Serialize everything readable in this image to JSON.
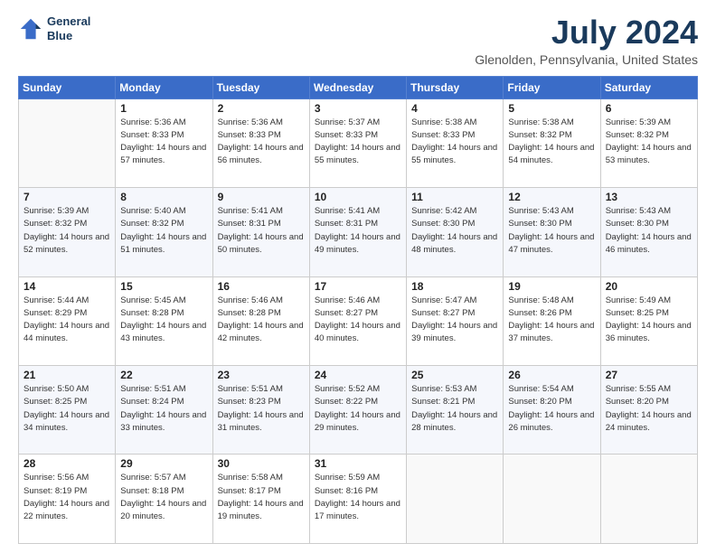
{
  "header": {
    "logo_line1": "General",
    "logo_line2": "Blue",
    "title": "July 2024",
    "subtitle": "Glenolden, Pennsylvania, United States"
  },
  "weekdays": [
    "Sunday",
    "Monday",
    "Tuesday",
    "Wednesday",
    "Thursday",
    "Friday",
    "Saturday"
  ],
  "weeks": [
    [
      {
        "day": "",
        "sunrise": "",
        "sunset": "",
        "daylight": ""
      },
      {
        "day": "1",
        "sunrise": "Sunrise: 5:36 AM",
        "sunset": "Sunset: 8:33 PM",
        "daylight": "Daylight: 14 hours and 57 minutes."
      },
      {
        "day": "2",
        "sunrise": "Sunrise: 5:36 AM",
        "sunset": "Sunset: 8:33 PM",
        "daylight": "Daylight: 14 hours and 56 minutes."
      },
      {
        "day": "3",
        "sunrise": "Sunrise: 5:37 AM",
        "sunset": "Sunset: 8:33 PM",
        "daylight": "Daylight: 14 hours and 55 minutes."
      },
      {
        "day": "4",
        "sunrise": "Sunrise: 5:38 AM",
        "sunset": "Sunset: 8:33 PM",
        "daylight": "Daylight: 14 hours and 55 minutes."
      },
      {
        "day": "5",
        "sunrise": "Sunrise: 5:38 AM",
        "sunset": "Sunset: 8:32 PM",
        "daylight": "Daylight: 14 hours and 54 minutes."
      },
      {
        "day": "6",
        "sunrise": "Sunrise: 5:39 AM",
        "sunset": "Sunset: 8:32 PM",
        "daylight": "Daylight: 14 hours and 53 minutes."
      }
    ],
    [
      {
        "day": "7",
        "sunrise": "Sunrise: 5:39 AM",
        "sunset": "Sunset: 8:32 PM",
        "daylight": "Daylight: 14 hours and 52 minutes."
      },
      {
        "day": "8",
        "sunrise": "Sunrise: 5:40 AM",
        "sunset": "Sunset: 8:32 PM",
        "daylight": "Daylight: 14 hours and 51 minutes."
      },
      {
        "day": "9",
        "sunrise": "Sunrise: 5:41 AM",
        "sunset": "Sunset: 8:31 PM",
        "daylight": "Daylight: 14 hours and 50 minutes."
      },
      {
        "day": "10",
        "sunrise": "Sunrise: 5:41 AM",
        "sunset": "Sunset: 8:31 PM",
        "daylight": "Daylight: 14 hours and 49 minutes."
      },
      {
        "day": "11",
        "sunrise": "Sunrise: 5:42 AM",
        "sunset": "Sunset: 8:30 PM",
        "daylight": "Daylight: 14 hours and 48 minutes."
      },
      {
        "day": "12",
        "sunrise": "Sunrise: 5:43 AM",
        "sunset": "Sunset: 8:30 PM",
        "daylight": "Daylight: 14 hours and 47 minutes."
      },
      {
        "day": "13",
        "sunrise": "Sunrise: 5:43 AM",
        "sunset": "Sunset: 8:30 PM",
        "daylight": "Daylight: 14 hours and 46 minutes."
      }
    ],
    [
      {
        "day": "14",
        "sunrise": "Sunrise: 5:44 AM",
        "sunset": "Sunset: 8:29 PM",
        "daylight": "Daylight: 14 hours and 44 minutes."
      },
      {
        "day": "15",
        "sunrise": "Sunrise: 5:45 AM",
        "sunset": "Sunset: 8:28 PM",
        "daylight": "Daylight: 14 hours and 43 minutes."
      },
      {
        "day": "16",
        "sunrise": "Sunrise: 5:46 AM",
        "sunset": "Sunset: 8:28 PM",
        "daylight": "Daylight: 14 hours and 42 minutes."
      },
      {
        "day": "17",
        "sunrise": "Sunrise: 5:46 AM",
        "sunset": "Sunset: 8:27 PM",
        "daylight": "Daylight: 14 hours and 40 minutes."
      },
      {
        "day": "18",
        "sunrise": "Sunrise: 5:47 AM",
        "sunset": "Sunset: 8:27 PM",
        "daylight": "Daylight: 14 hours and 39 minutes."
      },
      {
        "day": "19",
        "sunrise": "Sunrise: 5:48 AM",
        "sunset": "Sunset: 8:26 PM",
        "daylight": "Daylight: 14 hours and 37 minutes."
      },
      {
        "day": "20",
        "sunrise": "Sunrise: 5:49 AM",
        "sunset": "Sunset: 8:25 PM",
        "daylight": "Daylight: 14 hours and 36 minutes."
      }
    ],
    [
      {
        "day": "21",
        "sunrise": "Sunrise: 5:50 AM",
        "sunset": "Sunset: 8:25 PM",
        "daylight": "Daylight: 14 hours and 34 minutes."
      },
      {
        "day": "22",
        "sunrise": "Sunrise: 5:51 AM",
        "sunset": "Sunset: 8:24 PM",
        "daylight": "Daylight: 14 hours and 33 minutes."
      },
      {
        "day": "23",
        "sunrise": "Sunrise: 5:51 AM",
        "sunset": "Sunset: 8:23 PM",
        "daylight": "Daylight: 14 hours and 31 minutes."
      },
      {
        "day": "24",
        "sunrise": "Sunrise: 5:52 AM",
        "sunset": "Sunset: 8:22 PM",
        "daylight": "Daylight: 14 hours and 29 minutes."
      },
      {
        "day": "25",
        "sunrise": "Sunrise: 5:53 AM",
        "sunset": "Sunset: 8:21 PM",
        "daylight": "Daylight: 14 hours and 28 minutes."
      },
      {
        "day": "26",
        "sunrise": "Sunrise: 5:54 AM",
        "sunset": "Sunset: 8:20 PM",
        "daylight": "Daylight: 14 hours and 26 minutes."
      },
      {
        "day": "27",
        "sunrise": "Sunrise: 5:55 AM",
        "sunset": "Sunset: 8:20 PM",
        "daylight": "Daylight: 14 hours and 24 minutes."
      }
    ],
    [
      {
        "day": "28",
        "sunrise": "Sunrise: 5:56 AM",
        "sunset": "Sunset: 8:19 PM",
        "daylight": "Daylight: 14 hours and 22 minutes."
      },
      {
        "day": "29",
        "sunrise": "Sunrise: 5:57 AM",
        "sunset": "Sunset: 8:18 PM",
        "daylight": "Daylight: 14 hours and 20 minutes."
      },
      {
        "day": "30",
        "sunrise": "Sunrise: 5:58 AM",
        "sunset": "Sunset: 8:17 PM",
        "daylight": "Daylight: 14 hours and 19 minutes."
      },
      {
        "day": "31",
        "sunrise": "Sunrise: 5:59 AM",
        "sunset": "Sunset: 8:16 PM",
        "daylight": "Daylight: 14 hours and 17 minutes."
      },
      {
        "day": "",
        "sunrise": "",
        "sunset": "",
        "daylight": ""
      },
      {
        "day": "",
        "sunrise": "",
        "sunset": "",
        "daylight": ""
      },
      {
        "day": "",
        "sunrise": "",
        "sunset": "",
        "daylight": ""
      }
    ]
  ]
}
